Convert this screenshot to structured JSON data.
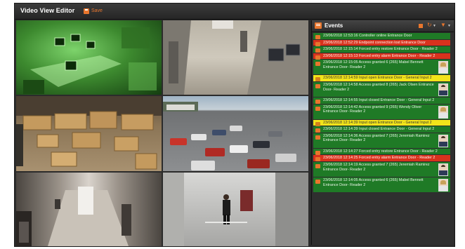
{
  "app": {
    "title": "Video View Editor",
    "save_label": "Save"
  },
  "events_panel": {
    "title": "Events",
    "items": [
      {
        "color": "green",
        "text": "23/06/2018 12:53:16 Controller online  Entrance Door",
        "photo": false
      },
      {
        "color": "red",
        "text": "23/06/2018 12:52:29 Endpoint connection lost  Entrance Door",
        "photo": false
      },
      {
        "color": "green",
        "text": "23/06/2018 12:15:14 Forced entry restore  Entrance Door - Reader 2",
        "photo": false
      },
      {
        "color": "red",
        "text": "23/06/2018 12:15:13 Forced entry alarm  Entrance Door - Reader 2",
        "photo": false
      },
      {
        "color": "green",
        "text": "23/06/2018 12:15:05 Access granted  6 (265) Mabel Bennett  Entrance Door- Reader 2",
        "photo": true,
        "photo_style": "f"
      },
      {
        "color": "yellow",
        "text": "23/06/2018 12:14:59  Input open  Entrance Door - General Input 2",
        "photo": false
      },
      {
        "color": "green",
        "text": "23/06/2018 12:14:58 Access granted  8 (265) Jack Olsen  Entrance Door- Reader 2",
        "photo": true,
        "photo_style": "m"
      },
      {
        "color": "green",
        "text": "23/06/2018 12:14:55  Input closed  Entrance Door - General Input 2",
        "photo": false
      },
      {
        "color": "green",
        "text": "23/06/2018 12:14:42 Access granted  9 (265) Wendy Oliver  Entrance Door- Reader 2",
        "photo": true,
        "photo_style": "f"
      },
      {
        "color": "yellow",
        "text": "23/06/2018 12:14:39  Input open  Entrance Door - General Input 2",
        "photo": false
      },
      {
        "color": "green",
        "text": "23/06/2018 12:14:39  Input closed  Entrance Door - General Input 2",
        "photo": false
      },
      {
        "color": "green",
        "text": "23/06/2018 12:14:36 Access granted  7 (265) Jeremiah Ramirez  Entrance Door- Reader 2",
        "photo": true,
        "photo_style": "m"
      },
      {
        "color": "green",
        "text": "23/06/2018 12:14:27 Forced entry restore  Entrance Door - Reader 2",
        "photo": false
      },
      {
        "color": "red",
        "text": "23/06/2018 12:14:25 Forced entry alarm  Entrance Door - Reader 2",
        "photo": false
      },
      {
        "color": "green",
        "text": "23/06/2018 12:14:19 Access granted  7 (265) Jeremiah Ramirez  Entrance Door- Reader 2",
        "photo": true,
        "photo_style": "m"
      },
      {
        "color": "green",
        "text": "23/06/2018 12:14:05 Access granted  6 (265) Mabel Bennett  Entrance Door- Reader 2",
        "photo": true,
        "photo_style": "f"
      }
    ]
  },
  "cameras": [
    {
      "id": "office-night-vision"
    },
    {
      "id": "warehouse-aisles"
    },
    {
      "id": "warehouse-boxes"
    },
    {
      "id": "parking-lot"
    },
    {
      "id": "corridor"
    },
    {
      "id": "lobby-person"
    }
  ],
  "colors": {
    "accent": "#e8762d",
    "event_green": "#1f7a26",
    "event_red": "#d8321d",
    "event_yellow": "#f2e41a"
  }
}
